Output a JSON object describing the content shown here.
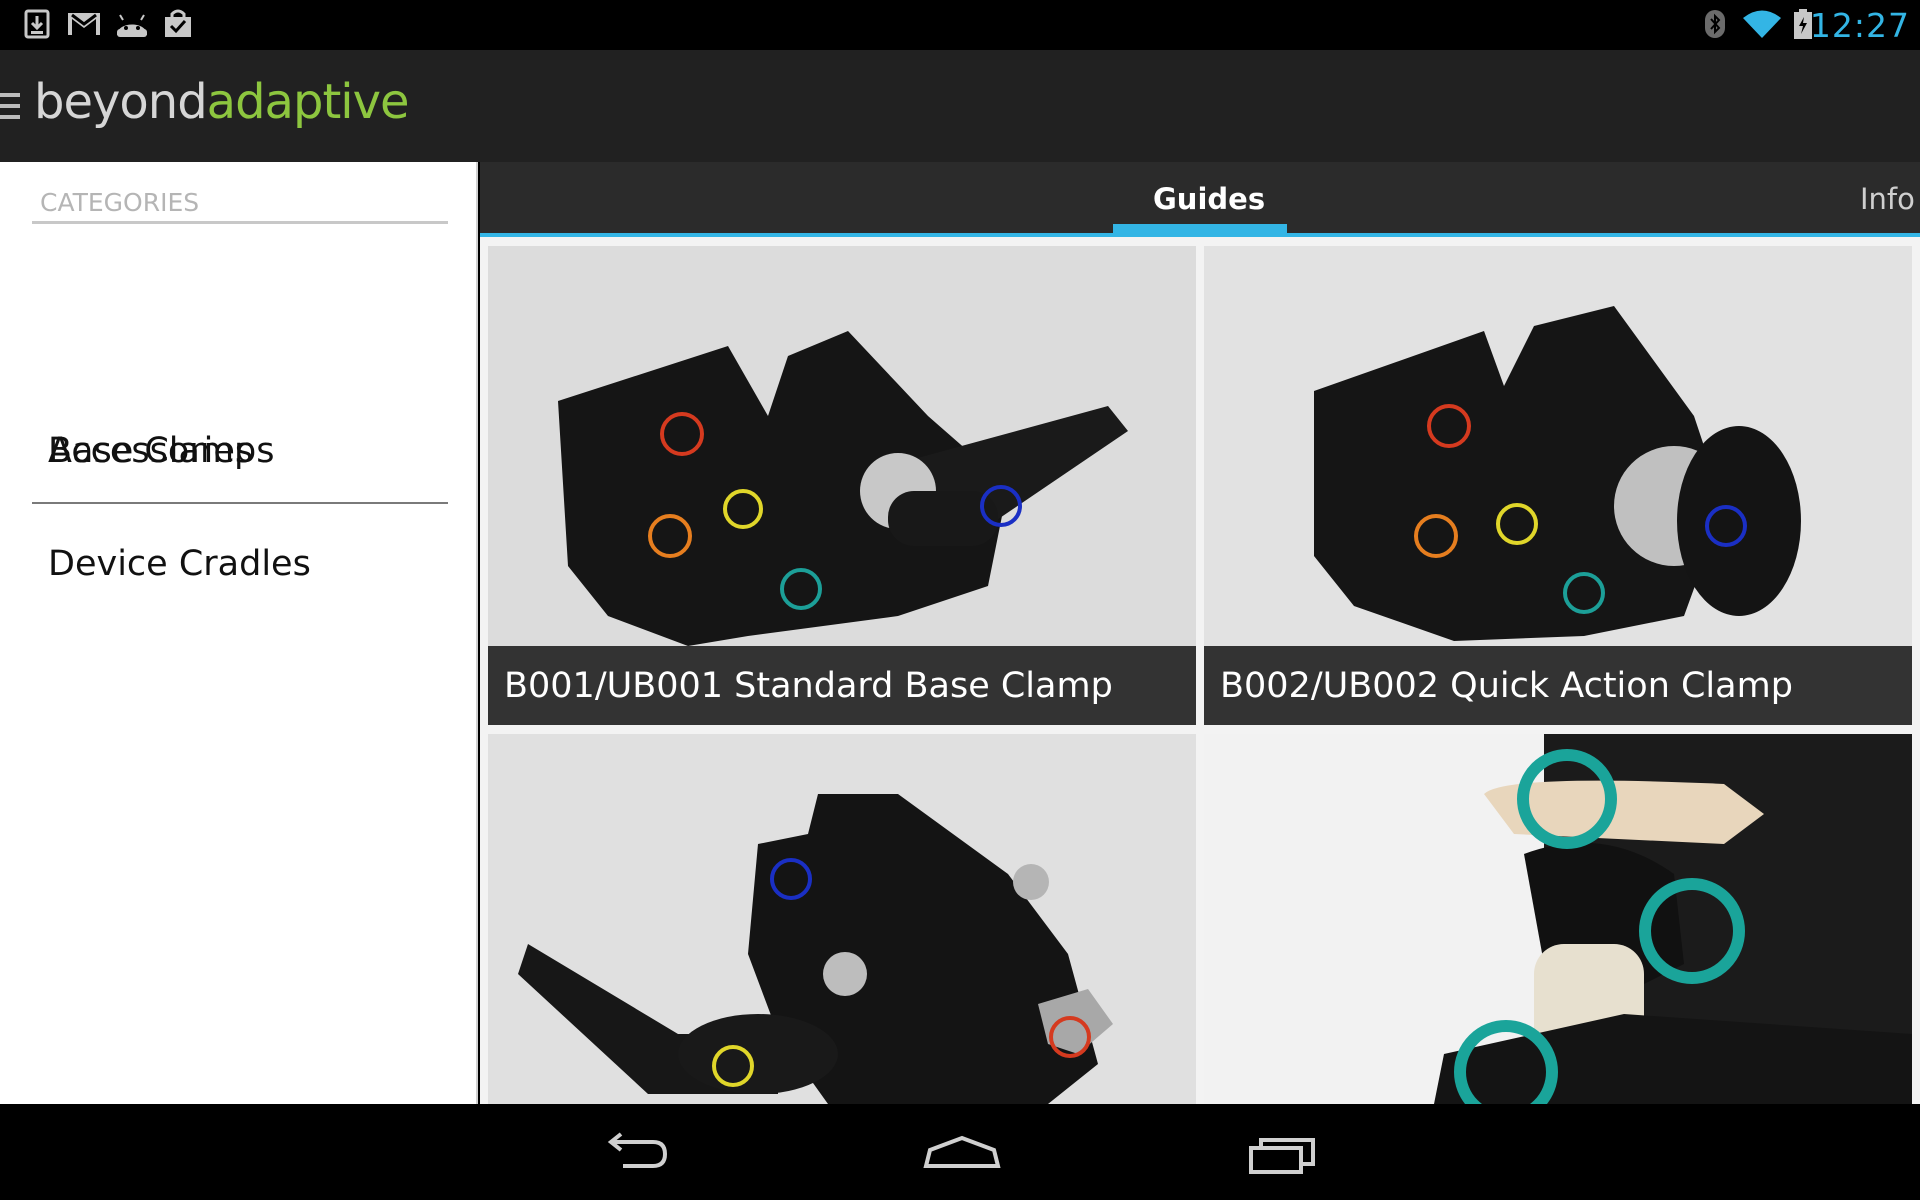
{
  "status_bar": {
    "time": "12:27",
    "left_icons": [
      "download-icon",
      "gmail-icon",
      "android-icon",
      "shopping-bag-icon"
    ],
    "right_icons": [
      "bluetooth-icon",
      "wifi-icon",
      "battery-icon"
    ],
    "accent": "#33b5e5"
  },
  "action_bar": {
    "logo_part1": "beyond",
    "logo_part2": "adaptive",
    "logo_colors": {
      "part1": "#d6d6d6",
      "part2": "#8dc63f"
    }
  },
  "sidebar": {
    "header": "CATEGORIES",
    "items": [
      {
        "label": "Accessories"
      },
      {
        "label": "Base Clamps"
      },
      {
        "label": "Device Cradles"
      }
    ]
  },
  "tabs": [
    {
      "label": "Guides",
      "active": true
    },
    {
      "label": "Info",
      "active": false
    }
  ],
  "guides": [
    {
      "title": "B001/UB001 Standard Base Clamp"
    },
    {
      "title": "B002/UB002 Quick Action Clamp"
    },
    {
      "title": ""
    },
    {
      "title": ""
    }
  ],
  "nav_bar": {
    "buttons": [
      "back-icon",
      "home-icon",
      "recent-apps-icon"
    ]
  }
}
